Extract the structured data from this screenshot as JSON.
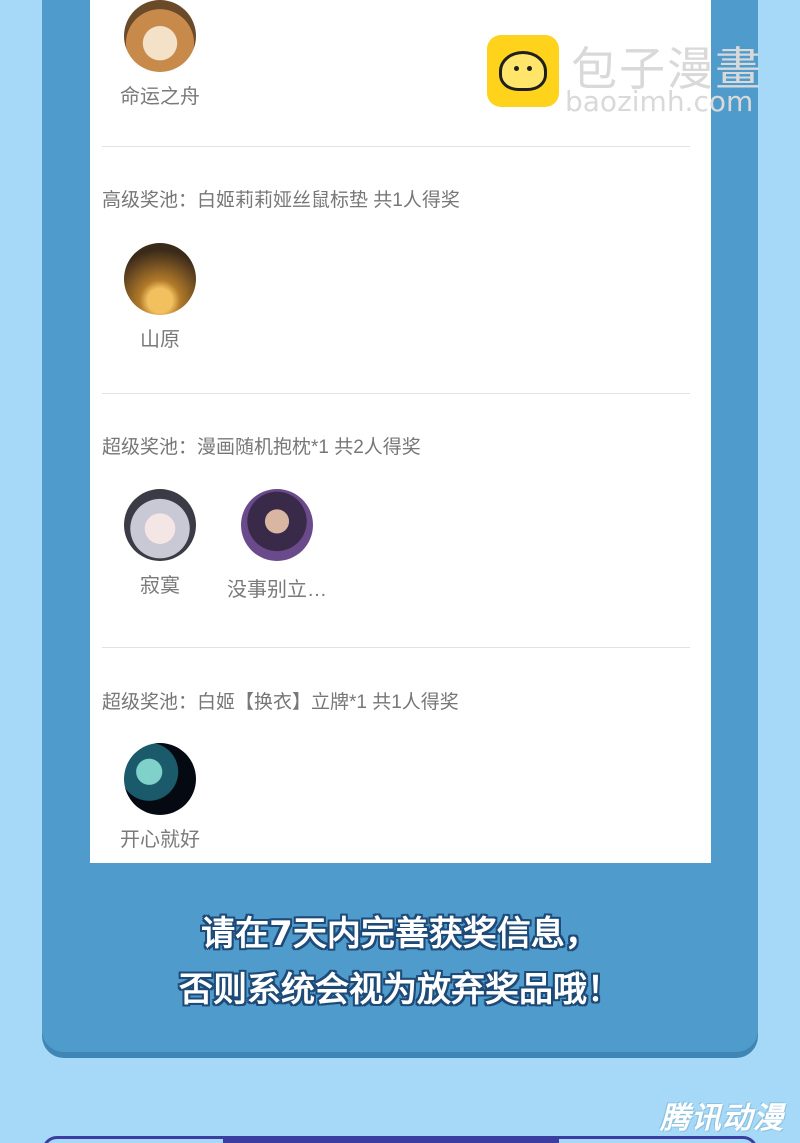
{
  "brand": {
    "name": "包子漫畫",
    "url": "baozimh.com"
  },
  "pools": [
    {
      "winners": [
        {
          "name": "命运之舟",
          "avatar": "shiba-dog-avatar"
        }
      ]
    },
    {
      "label": "高级奖池：白姬莉莉娅丝鼠标垫 共1人得奖",
      "winners": [
        {
          "name": "山原",
          "avatar": "penguin-avatar"
        }
      ]
    },
    {
      "label": "超级奖池：漫画随机抱枕*1 共2人得奖",
      "winners": [
        {
          "name": "寂寞",
          "avatar": "anime-girl-avatar"
        },
        {
          "name": "没事别立…",
          "avatar": "anime-boy-avatar"
        }
      ]
    },
    {
      "label": "超级奖池：白姬【换衣】立牌*1 共1人得奖",
      "winners": [
        {
          "name": "开心就好",
          "avatar": "space-planet-avatar"
        }
      ]
    }
  ],
  "notice": {
    "line1": "请在7天内完善获奖信息，",
    "line2": "否则系统会视为放弃奖品哦！"
  },
  "watermark": "腾讯动漫",
  "colors": {
    "background": "#a6d9f7",
    "panel": "#4f9ccc",
    "card": "#ffffff",
    "notice_outline": "#1e4a78"
  }
}
